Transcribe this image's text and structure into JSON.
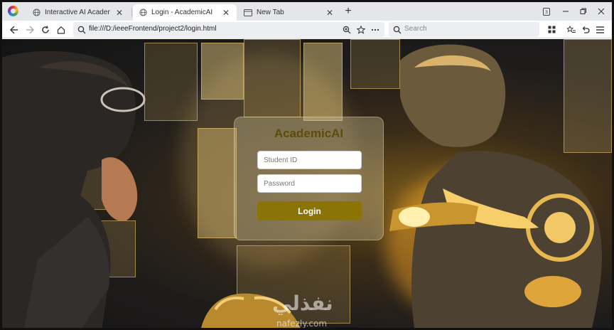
{
  "browser": {
    "tabs": [
      {
        "label": "Interactive AI Academic Advis",
        "active": false
      },
      {
        "label": "Login - AcademicAI",
        "active": true
      },
      {
        "label": "New Tab",
        "active": false
      }
    ],
    "url": "file:///D:/ieeeFrontend/project2/login.html",
    "search_placeholder": "Search"
  },
  "login": {
    "title": "AcademicAI",
    "student_id_placeholder": "Student ID",
    "password_placeholder": "Password",
    "button_label": "Login"
  },
  "watermark": {
    "arabic": "نفذلي",
    "latin": "nafezly.com"
  },
  "colors": {
    "login_button": "#8b7406",
    "title_text": "#5e4c0c"
  }
}
